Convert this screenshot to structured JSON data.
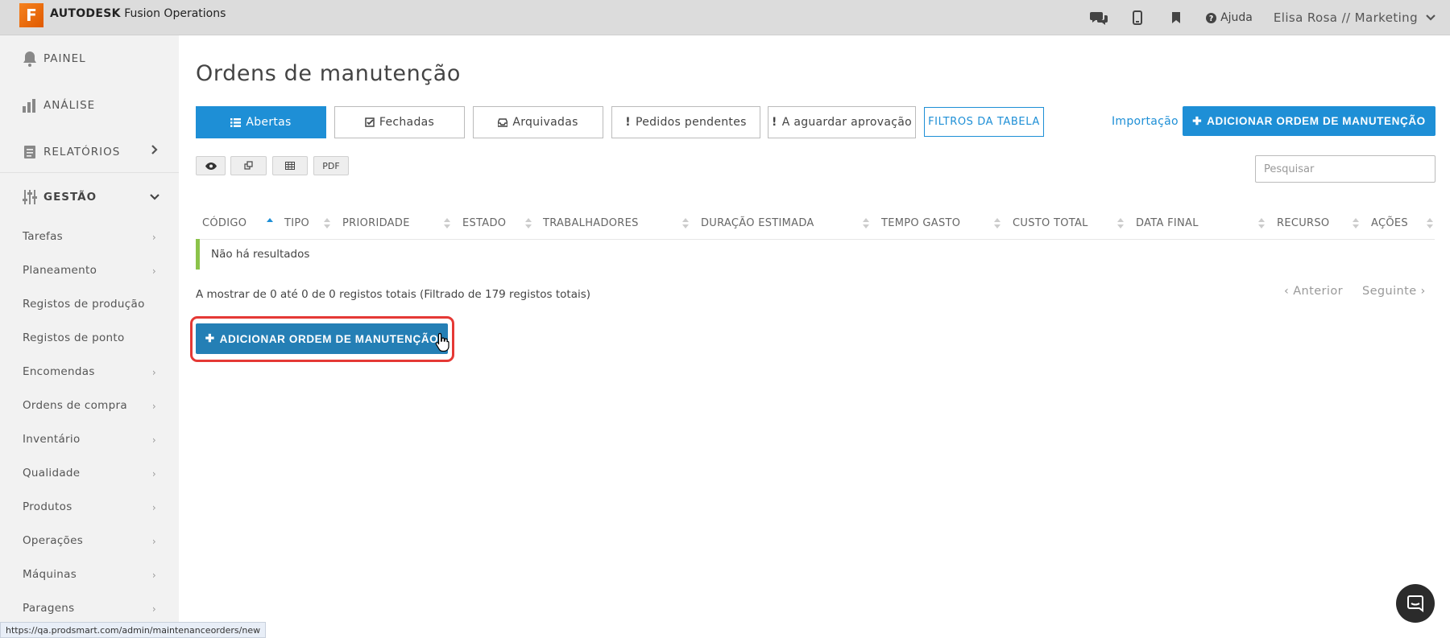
{
  "app": {
    "logo_letter": "F",
    "brand_bold": "AUTODESK",
    "brand_rest": " Fusion Operations",
    "accent_color": "#1e8fd6",
    "brand_color": "#f58220"
  },
  "topbar": {
    "icons": [
      "chat-icon",
      "mobile-icon",
      "bookmark-icon"
    ],
    "help_label": "Ajuda",
    "user_label": "Elisa Rosa // Marketing"
  },
  "sidebar": {
    "main_items": [
      {
        "label": "PAINEL",
        "icon": "bell-icon"
      },
      {
        "label": "ANÁLISE",
        "icon": "bar-chart-icon"
      },
      {
        "label": "RELATÓRIOS",
        "icon": "report-icon"
      },
      {
        "label": "GESTÃO",
        "icon": "sliders-icon"
      }
    ],
    "sub_items": [
      {
        "label": "Tarefas"
      },
      {
        "label": "Planeamento"
      },
      {
        "label": "Registos de produção"
      },
      {
        "label": "Registos de ponto"
      },
      {
        "label": "Encomendas"
      },
      {
        "label": "Ordens de compra"
      },
      {
        "label": "Inventário"
      },
      {
        "label": "Qualidade"
      },
      {
        "label": "Produtos"
      },
      {
        "label": "Operações"
      },
      {
        "label": "Máquinas"
      },
      {
        "label": "Paragens"
      }
    ]
  },
  "main": {
    "title": "Ordens de manutenção",
    "tabs": [
      {
        "label": "Abertas",
        "icon": "list-icon"
      },
      {
        "label": "Fechadas",
        "icon": "check-square-icon"
      },
      {
        "label": "Arquivadas",
        "icon": "inbox-icon"
      },
      {
        "label": "Pedidos pendentes",
        "icon": "exclamation-icon"
      },
      {
        "label": "A aguardar aprovação",
        "icon": "exclamation-icon"
      }
    ],
    "filters_label": "FILTROS DA TABELA",
    "import_label": "Importação",
    "add_label": "ADICIONAR ORDEM DE MANUTENÇÃO",
    "tools": {
      "view": "eye-icon",
      "copy": "copy-icon",
      "table": "table-icon",
      "pdf": "PDF"
    },
    "search_placeholder": "Pesquisar",
    "columns": [
      "CÓDIGO",
      "TIPO",
      "PRIORIDADE",
      "ESTADO",
      "TRABALHADORES",
      "DURAÇÃO ESTIMADA",
      "TEMPO GASTO",
      "CUSTO TOTAL",
      "DATA FINAL",
      "RECURSO",
      "AÇÕES"
    ],
    "sorted_column": "CÓDIGO",
    "empty_message": "Não há resultados",
    "info_text": "A mostrar de 0 até 0 de 0 registos totais (Filtrado de 179 registos totais)",
    "prev_label": "Anterior",
    "next_label": "Seguinte",
    "bottom_add_label": "ADICIONAR ORDEM DE MANUTENÇÃO"
  },
  "status_url": "https://qa.prodsmart.com/admin/maintenanceorders/new"
}
